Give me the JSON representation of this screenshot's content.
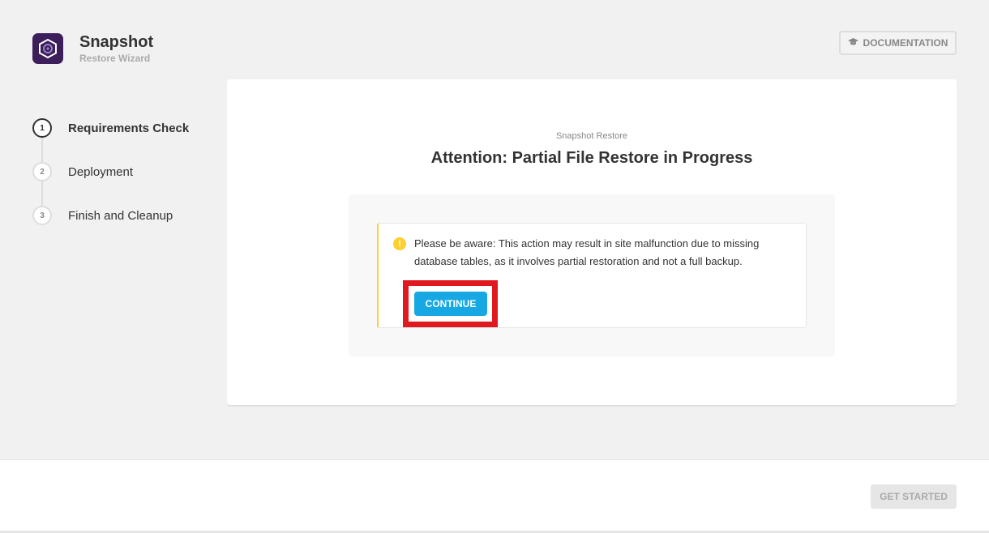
{
  "app": {
    "title": "Snapshot",
    "subtitle": "Restore Wizard",
    "logo_icon": "snapshot-logo-icon",
    "logo_color": "#3b1e5a"
  },
  "header": {
    "documentation_label": "DOCUMENTATION",
    "documentation_icon": "graduation-cap-icon"
  },
  "steps": [
    {
      "number": "1",
      "label": "Requirements Check",
      "active": true
    },
    {
      "number": "2",
      "label": "Deployment",
      "active": false
    },
    {
      "number": "3",
      "label": "Finish and Cleanup",
      "active": false
    }
  ],
  "main": {
    "eyebrow": "Snapshot Restore",
    "title": "Attention: Partial File Restore in Progress",
    "notice": {
      "icon": "warning-icon",
      "icon_glyph": "!",
      "text": "Please be aware: This action may result in site malfunction due to missing database tables, as it involves partial restoration and not a full backup.",
      "accent_color": "#fecf2f"
    },
    "continue_label": "CONTINUE",
    "continue_color": "#17a8e3",
    "highlight_color": "#e0191f"
  },
  "footer": {
    "get_started_label": "GET STARTED",
    "get_started_disabled": true
  }
}
